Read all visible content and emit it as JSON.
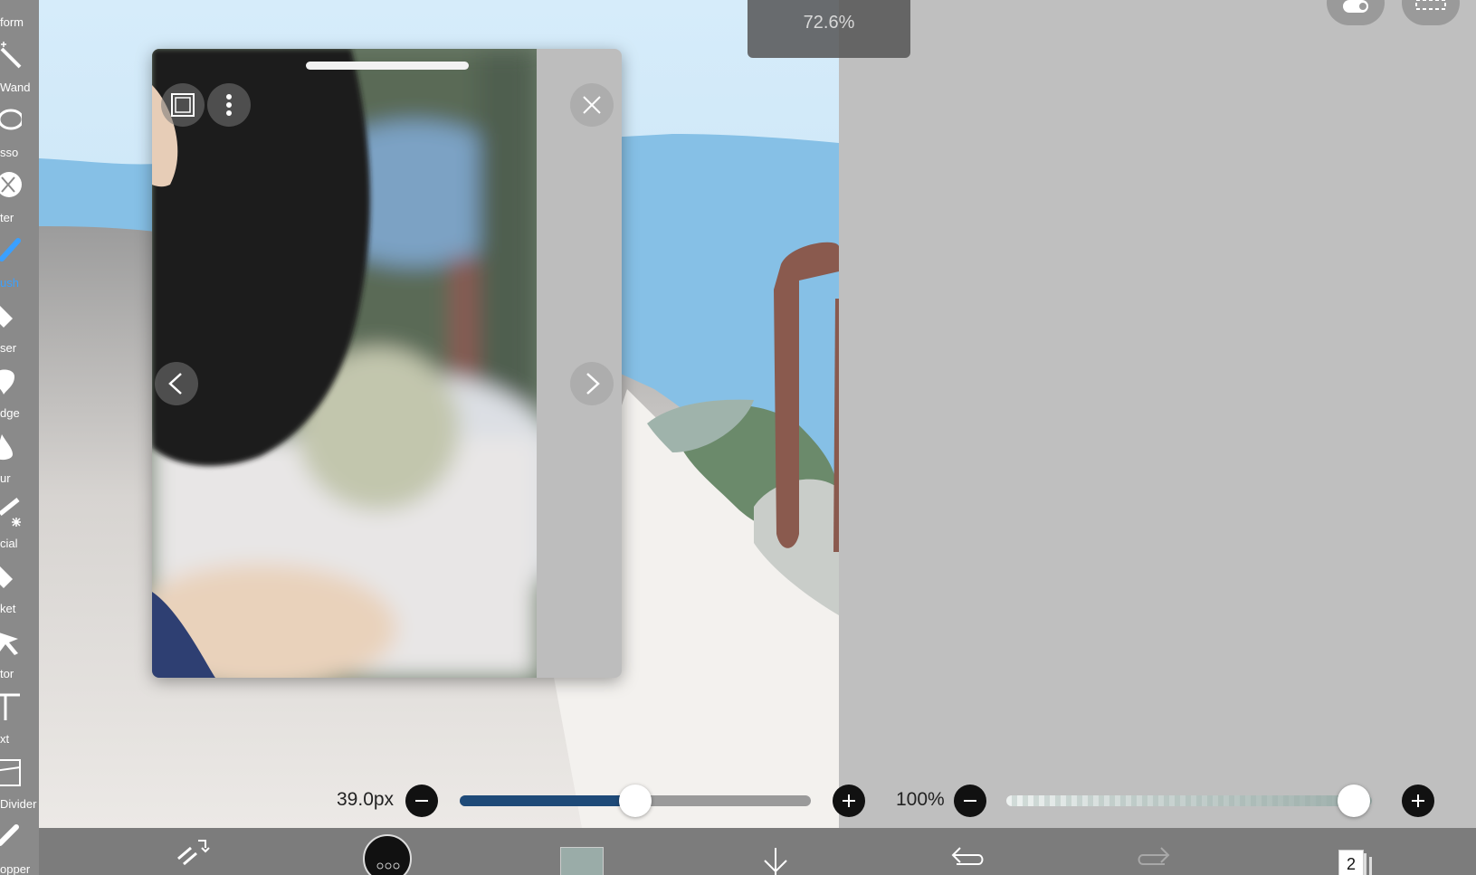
{
  "tools": [
    {
      "id": "transform",
      "label": "form",
      "icon": "transform-icon",
      "active": false
    },
    {
      "id": "magic-wand",
      "label": "Wand",
      "icon": "magic-wand-icon",
      "active": false
    },
    {
      "id": "lasso",
      "label": "sso",
      "icon": "lasso-icon",
      "active": false
    },
    {
      "id": "filter",
      "label": "ter",
      "icon": "filter-icon",
      "active": false
    },
    {
      "id": "brush",
      "label": "ush",
      "icon": "brush-icon",
      "active": true
    },
    {
      "id": "eraser",
      "label": "ser",
      "icon": "eraser-icon",
      "active": false
    },
    {
      "id": "smudge",
      "label": "dge",
      "icon": "smudge-icon",
      "active": false
    },
    {
      "id": "blur",
      "label": "ur",
      "icon": "blur-icon",
      "active": false
    },
    {
      "id": "special",
      "label": "cial",
      "icon": "special-icon",
      "active": false
    },
    {
      "id": "bucket",
      "label": "ket",
      "icon": "bucket-icon",
      "active": false
    },
    {
      "id": "vector",
      "label": "tor",
      "icon": "vector-icon",
      "active": false
    },
    {
      "id": "text",
      "label": "xt",
      "icon": "text-icon",
      "active": false
    },
    {
      "id": "divider",
      "label": "Divider",
      "icon": "divider-icon",
      "active": false
    },
    {
      "id": "eyedropper",
      "label": "opper",
      "icon": "eyedropper-icon",
      "active": false
    }
  ],
  "zoom": {
    "label": "72.6%"
  },
  "brush_size": {
    "label": "39.0px",
    "fraction": 0.5
  },
  "opacity": {
    "label": "100%",
    "fraction": 1.0
  },
  "layers": {
    "count": "2"
  },
  "colors": {
    "accent": "#3aa0ff",
    "brush_track": "#1e4a78",
    "current_color": "#9aaca8",
    "sky": "#8cc3e8",
    "tree_trunk": "#8a5a4e",
    "foliage": "#6b8a6b"
  }
}
